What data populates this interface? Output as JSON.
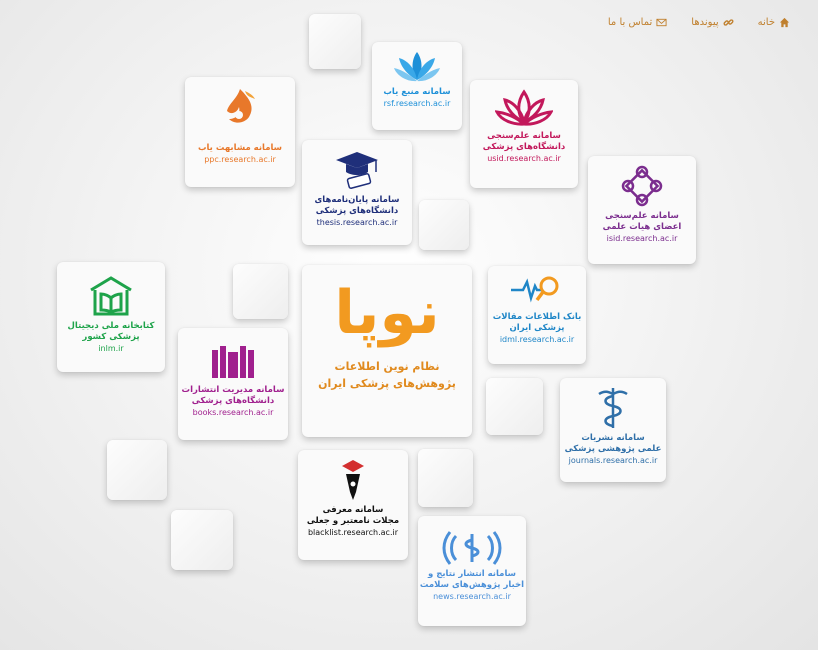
{
  "nav": {
    "home": "خانه",
    "links": "پیوندها",
    "contact": "تماس با ما"
  },
  "center": {
    "brand": "نوپا",
    "line1": "نظام نوین اطلاعات",
    "line2": "پژوهش‌های پزشکی ایران"
  },
  "tiles": {
    "ppc": {
      "title": "سامانه مشابهت یاب",
      "url": "ppc.research.ac.ir",
      "color": "#e8782a"
    },
    "rsf": {
      "title": "سامانه منبع یاب",
      "url": "rsf.research.ac.ir",
      "color": "#1e90d8"
    },
    "usid": {
      "title1": "سامانه علم‌سنجی",
      "title2": "دانشگاه‌های پزشکی",
      "url": "usid.research.ac.ir",
      "color": "#c2185b"
    },
    "thesis": {
      "title1": "سامانه پایان‌نامه‌های",
      "title2": "دانشگاه‌های پزشکی",
      "url": "thesis.research.ac.ir",
      "color": "#1f2f7a"
    },
    "isid": {
      "title1": "سامانه علم‌سنجی",
      "title2": "اعضای هیات علمی",
      "url": "isid.research.ac.ir",
      "color": "#7b2d8e"
    },
    "inlm": {
      "title1": "کتابخانه ملی دیجیتال",
      "title2": "پزشکی کشور",
      "url": "inlm.ir",
      "color": "#1ea34a"
    },
    "idml": {
      "title1": "بانک اطلاعات مقالات",
      "title2": "پزشکی ایران",
      "url": "idml.research.ac.ir",
      "color": "#1f86c7"
    },
    "books": {
      "title1": "سامانه مدیریت انتشارات",
      "title2": "دانشگاه‌های پزشکی",
      "url": "books.research.ac.ir",
      "color": "#a0208e"
    },
    "journals": {
      "title1": "سامانه نشریات",
      "title2": "علمی پژوهشی پزشکی",
      "url": "journals.research.ac.ir",
      "color": "#2f6fa8"
    },
    "blacklist": {
      "title1": "سامانه معرفی",
      "title2": "مجلات نامعتبر و جعلی",
      "url": "blacklist.research.ac.ir",
      "color": "#111111"
    },
    "news": {
      "title1": "سامانه انتشار نتایج و",
      "title2": "اخبار پژوهش‌های سلامت",
      "url": "news.research.ac.ir",
      "color": "#4a8fd8"
    }
  }
}
